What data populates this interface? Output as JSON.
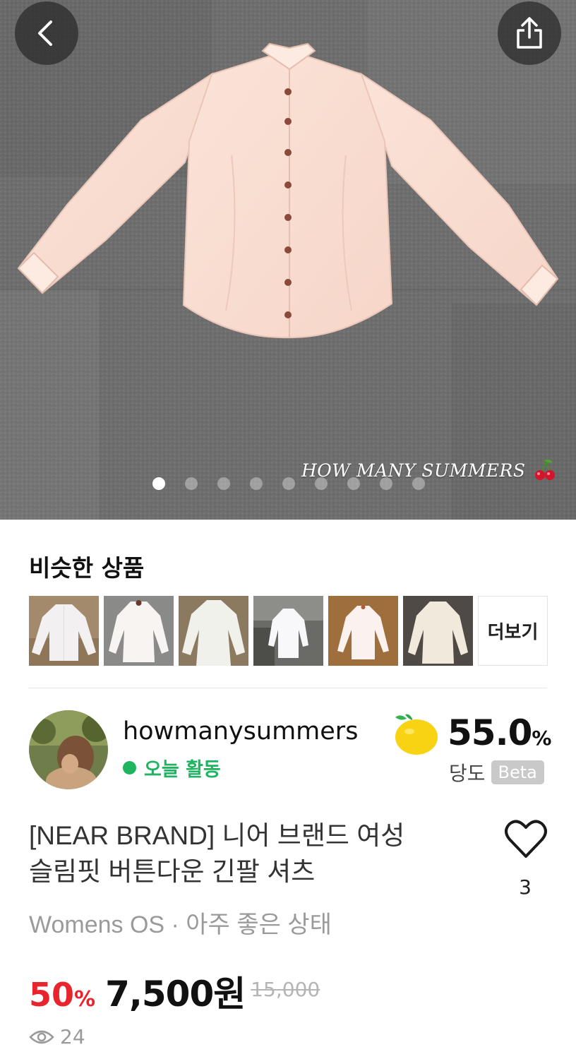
{
  "hero": {
    "watermark": "HOW MANY SUMMERS",
    "image_count": 9,
    "active_index": 0
  },
  "similar": {
    "title": "비슷한 상품",
    "more_label": "더보기"
  },
  "seller": {
    "name": "howmanysummers",
    "activity": "오늘 활동",
    "sweetness_value": "55.0",
    "sweetness_unit": "%",
    "sweetness_label": "당도",
    "beta_badge": "Beta"
  },
  "product": {
    "title_line1": "[NEAR BRAND] 니어 브랜드 여성",
    "title_line2": "슬림핏 버튼다운 긴팔 셔츠",
    "like_count": "3",
    "meta": "Womens OS · 아주 좋은 상태",
    "discount": "50",
    "discount_unit": "%",
    "price": "7,500원",
    "original_price": "15,000",
    "views": "24"
  },
  "colors": {
    "accent_red": "#e8242c",
    "active_green": "#1fb460"
  }
}
